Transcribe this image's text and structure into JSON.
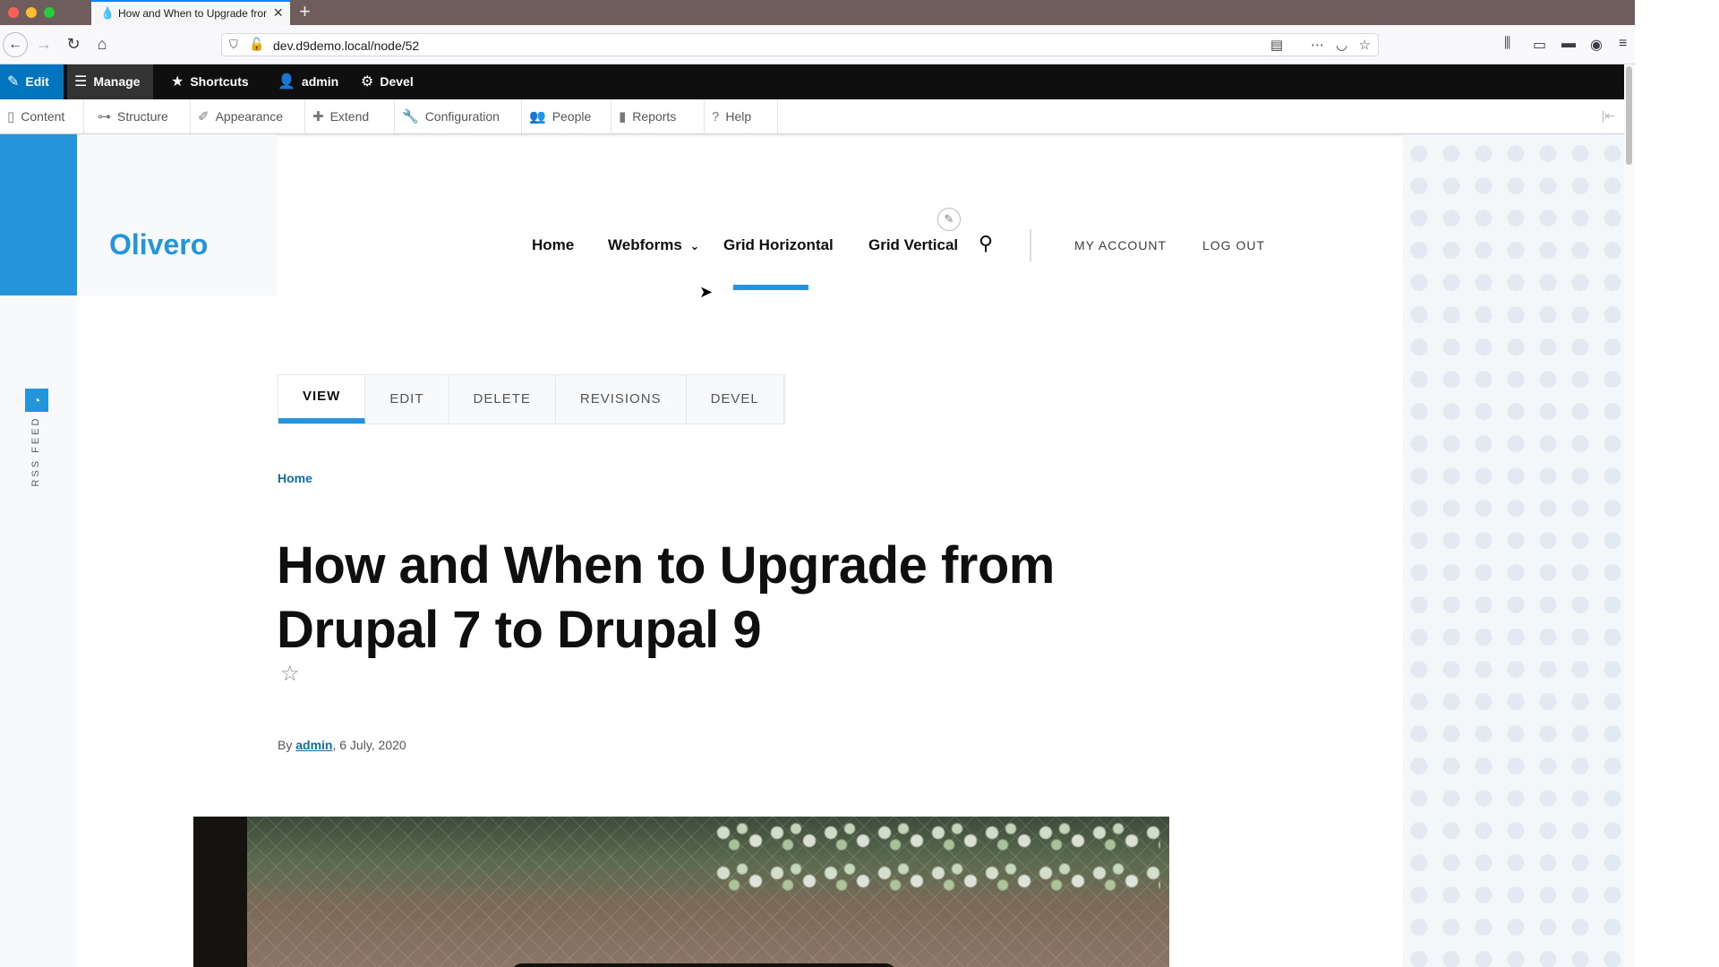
{
  "browser": {
    "tab_title": "How and When to Upgrade from Drupal 7 to Drupal 9",
    "url": "dev.d9demo.local/node/52"
  },
  "admin_toolbar": {
    "edit": "Edit",
    "manage": "Manage",
    "shortcuts": "Shortcuts",
    "user": "admin",
    "devel": "Devel"
  },
  "admin_tray": {
    "items": [
      "Content",
      "Structure",
      "Appearance",
      "Extend",
      "Configuration",
      "People",
      "Reports",
      "Help"
    ]
  },
  "site": {
    "logo": "Olivero",
    "main_nav": [
      "Home",
      "Webforms",
      "Grid Horizontal",
      "Grid Vertical"
    ],
    "secondary_nav": [
      "MY ACCOUNT",
      "LOG OUT"
    ],
    "rss_label": "RSS FEED"
  },
  "local_tasks": [
    "VIEW",
    "EDIT",
    "DELETE",
    "REVISIONS",
    "DEVEL"
  ],
  "breadcrumb": "Home",
  "article": {
    "title": "How and When to Upgrade from Drupal 7 to Drupal 9",
    "byline_prefix": "By",
    "author": "admin",
    "date": ", 6 July, 2020"
  },
  "colors": {
    "accent": "#2494db",
    "toolbar_bg": "#0f0f0f",
    "edit_bg": "#0074bd"
  }
}
